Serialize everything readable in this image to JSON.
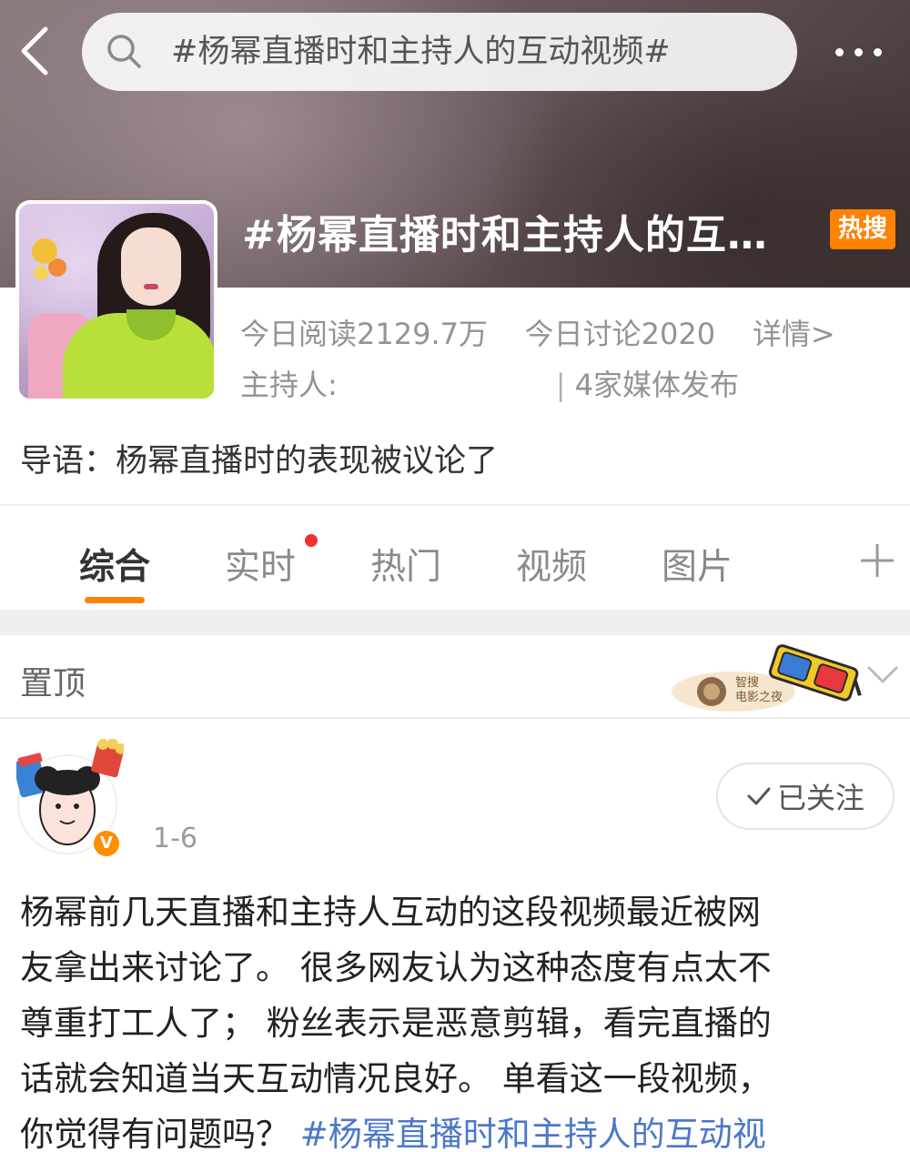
{
  "header": {
    "back_icon": "chevron-left-icon",
    "search_icon": "search-icon",
    "search_text": "#杨幂直播时和主持人的互动视频#",
    "more_icon": "more-dots-icon"
  },
  "topic": {
    "title": "#杨幂直播时和主持人的互…",
    "badge": "热搜",
    "reads": "今日阅读2129.7万",
    "discussions": "今日讨论2020",
    "detail_link": "详情>",
    "host_label": "主持人:",
    "media": "4家媒体发布",
    "lead": "导语：杨幂直播时的表现被议论了"
  },
  "tabs": [
    {
      "label": "综合",
      "active": true
    },
    {
      "label": "实时",
      "active": false
    },
    {
      "label": "热门",
      "active": false
    },
    {
      "label": "视频",
      "active": false
    },
    {
      "label": "图片",
      "active": false
    }
  ],
  "pinned": {
    "label": "置顶",
    "banner_text": "智搜 电影之夜"
  },
  "post": {
    "time": "1-6",
    "verify_mark": "V",
    "follow_label": "已关注",
    "lines": [
      "杨幂前几天直播和主持人互动的这段视频最近被网",
      "友拿出来讨论了。 很多网友认为这种态度有点太不",
      "尊重打工人了； 粉丝表示是恶意剪辑，看完直播的",
      "话就会知道当天互动情况良好。 单看这一段视频，"
    ],
    "last_line_text": "你觉得有问题吗？ ",
    "last_line_hashtag": "#杨幂直播时和主持人的互动视"
  },
  "colors": {
    "accent": "#ff8200",
    "hashtag": "#4b78c8",
    "red_dot": "#f13030"
  }
}
